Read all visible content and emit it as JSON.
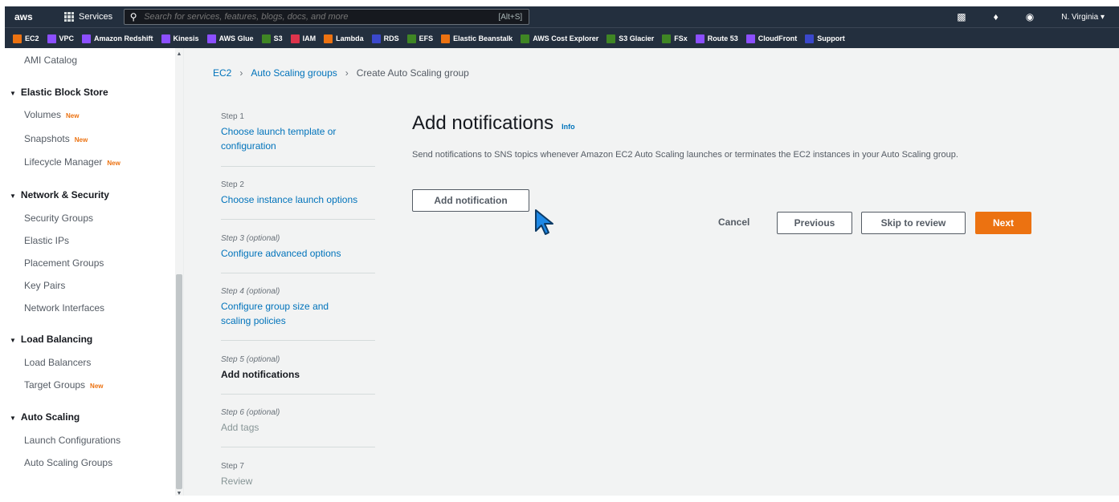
{
  "topnav": {
    "logo": "aws",
    "services_label": "Services",
    "search_placeholder": "Search for services, features, blogs, docs, and more",
    "search_shortcut": "[Alt+S]",
    "region": "N. Virginia ▾",
    "icons": [
      "cloudshell-icon",
      "bell-icon",
      "help-icon"
    ]
  },
  "favorites": [
    {
      "label": "EC2",
      "color": "#ec7211"
    },
    {
      "label": "VPC",
      "color": "#8c4fff"
    },
    {
      "label": "Amazon Redshift",
      "color": "#8c4fff"
    },
    {
      "label": "Kinesis",
      "color": "#8c4fff"
    },
    {
      "label": "AWS Glue",
      "color": "#8c4fff"
    },
    {
      "label": "S3",
      "color": "#3f8624"
    },
    {
      "label": "IAM",
      "color": "#dd344c"
    },
    {
      "label": "Lambda",
      "color": "#ec7211"
    },
    {
      "label": "RDS",
      "color": "#3b48cc"
    },
    {
      "label": "EFS",
      "color": "#3f8624"
    },
    {
      "label": "Elastic Beanstalk",
      "color": "#ec7211"
    },
    {
      "label": "AWS Cost Explorer",
      "color": "#3f8624"
    },
    {
      "label": "S3 Glacier",
      "color": "#3f8624"
    },
    {
      "label": "FSx",
      "color": "#3f8624"
    },
    {
      "label": "Route 53",
      "color": "#8c4fff"
    },
    {
      "label": "CloudFront",
      "color": "#8c4fff"
    },
    {
      "label": "Support",
      "color": "#3b48cc"
    }
  ],
  "sidebar": {
    "ami_catalog": "AMI Catalog",
    "ebs_header": "Elastic Block Store",
    "volumes": "Volumes",
    "snapshots": "Snapshots",
    "lifecycle": "Lifecycle Manager",
    "network_header": "Network & Security",
    "security_groups": "Security Groups",
    "elastic_ips": "Elastic IPs",
    "placement_groups": "Placement Groups",
    "key_pairs": "Key Pairs",
    "network_interfaces": "Network Interfaces",
    "lb_header": "Load Balancing",
    "load_balancers": "Load Balancers",
    "target_groups": "Target Groups",
    "as_header": "Auto Scaling",
    "launch_configs": "Launch Configurations",
    "as_groups": "Auto Scaling Groups",
    "new_badge": "New"
  },
  "breadcrumb": {
    "ec2": "EC2",
    "asg": "Auto Scaling groups",
    "current": "Create Auto Scaling group"
  },
  "steps": [
    {
      "num": "Step 1",
      "title": "Choose launch template or configuration"
    },
    {
      "num": "Step 2",
      "title": "Choose instance launch options"
    },
    {
      "num": "Step 3 (optional)",
      "title": "Configure advanced options"
    },
    {
      "num": "Step 4 (optional)",
      "title": "Configure group size and scaling policies"
    },
    {
      "num": "Step 5 (optional)",
      "title": "Add notifications"
    },
    {
      "num": "Step 6 (optional)",
      "title": "Add tags"
    },
    {
      "num": "Step 7",
      "title": "Review"
    }
  ],
  "content": {
    "title": "Add notifications",
    "info": "Info",
    "description": "Send notifications to SNS topics whenever Amazon EC2 Auto Scaling launches or terminates the EC2 instances in your Auto Scaling group.",
    "add_button": "Add notification",
    "cancel": "Cancel",
    "previous": "Previous",
    "skip": "Skip to review",
    "next": "Next"
  }
}
